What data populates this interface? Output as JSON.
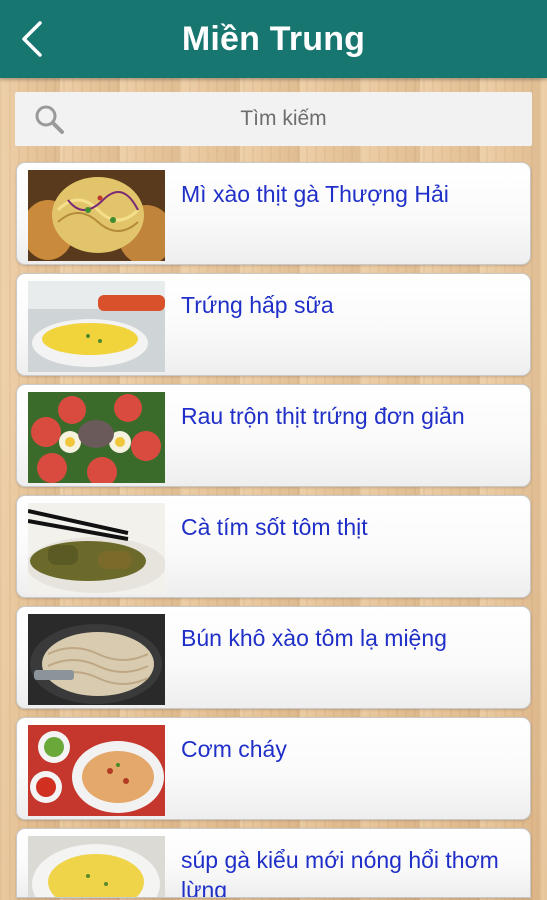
{
  "header": {
    "title": "Miền Trung",
    "back_icon": "chevron-left-icon"
  },
  "search": {
    "placeholder": "Tìm kiếm",
    "icon": "search-icon"
  },
  "colors": {
    "app_bar": "#17766f",
    "label_text": "#1f2fc8"
  },
  "recipes": [
    {
      "label": "Mì xào thịt gà Thượng Hải"
    },
    {
      "label": "Trứng hấp sữa"
    },
    {
      "label": "Rau trộn thịt trứng đơn giản"
    },
    {
      "label": "Cà tím sốt tôm thịt"
    },
    {
      "label": "Bún khô xào tôm lạ miệng"
    },
    {
      "label": "Cơm cháy"
    },
    {
      "label": "súp gà kiểu mới nóng hổi thơm lừng"
    }
  ]
}
